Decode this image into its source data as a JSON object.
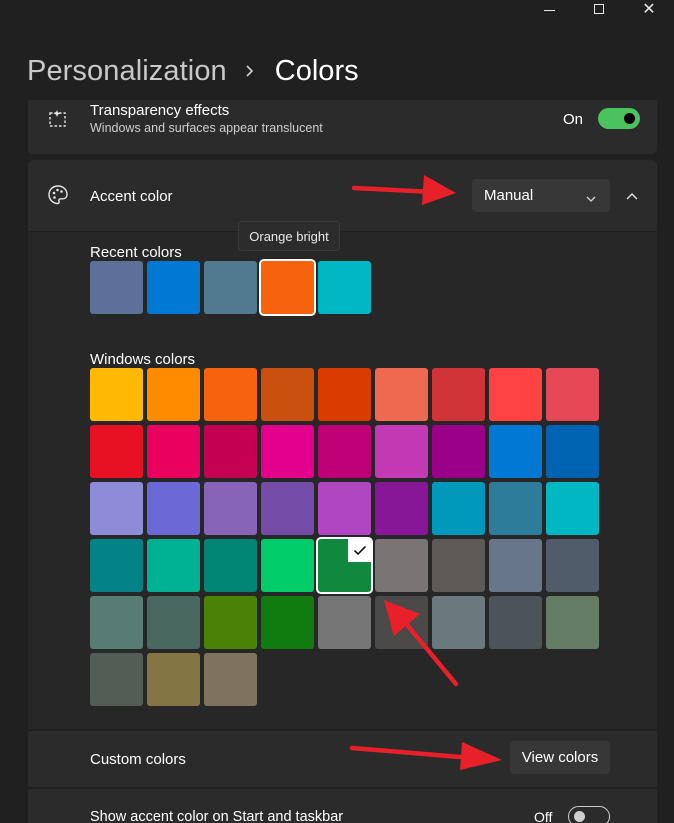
{
  "window": {
    "controls": [
      "minimize",
      "maximize",
      "close"
    ]
  },
  "breadcrumb": {
    "parent": "Personalization",
    "current": "Colors"
  },
  "transparency": {
    "icon": "transparency-icon",
    "title": "Transparency effects",
    "subtitle": "Windows and surfaces appear translucent",
    "state_label": "On",
    "state": true
  },
  "accent": {
    "icon": "palette-icon",
    "title": "Accent color",
    "dropdown_value": "Manual",
    "tooltip": "Orange bright",
    "recent_label": "Recent colors",
    "recent_colors": [
      "#5b7199",
      "#0078d4",
      "#4f7a8f",
      "#f7630c",
      "#00b7c3"
    ],
    "recent_selected_index": 3,
    "windows_label": "Windows colors",
    "windows_colors": [
      "#ffb900",
      "#ff8c00",
      "#f7630c",
      "#ca5010",
      "#da3b01",
      "#ef6950",
      "#d13438",
      "#ff4343",
      "#e74856",
      "#e81123",
      "#ea005e",
      "#c30052",
      "#e3008c",
      "#bf0077",
      "#c239b3",
      "#9a0089",
      "#0078d4",
      "#0063b1",
      "#8e8cd8",
      "#6b69d6",
      "#8764b8",
      "#744da9",
      "#b146c2",
      "#881798",
      "#0099bc",
      "#2d7d9a",
      "#00b7c3",
      "#038387",
      "#00b294",
      "#018574",
      "#00cc6a",
      "#10893e",
      "#7a7574",
      "#5d5a58",
      "#68768a",
      "#515c6b",
      "#567c73",
      "#486860",
      "#498205",
      "#107c10",
      "#767676",
      "#4c4a48",
      "#69797e",
      "#4a5459",
      "#647c64",
      "#525e54",
      "#847545",
      "#7e735f"
    ],
    "windows_selected_index": 31
  },
  "custom": {
    "label": "Custom colors",
    "button": "View colors"
  },
  "show_accent": {
    "label": "Show accent color on Start and taskbar",
    "state_label": "Off",
    "state": false
  },
  "annotations": {
    "arrow_color": "#e8202a"
  }
}
